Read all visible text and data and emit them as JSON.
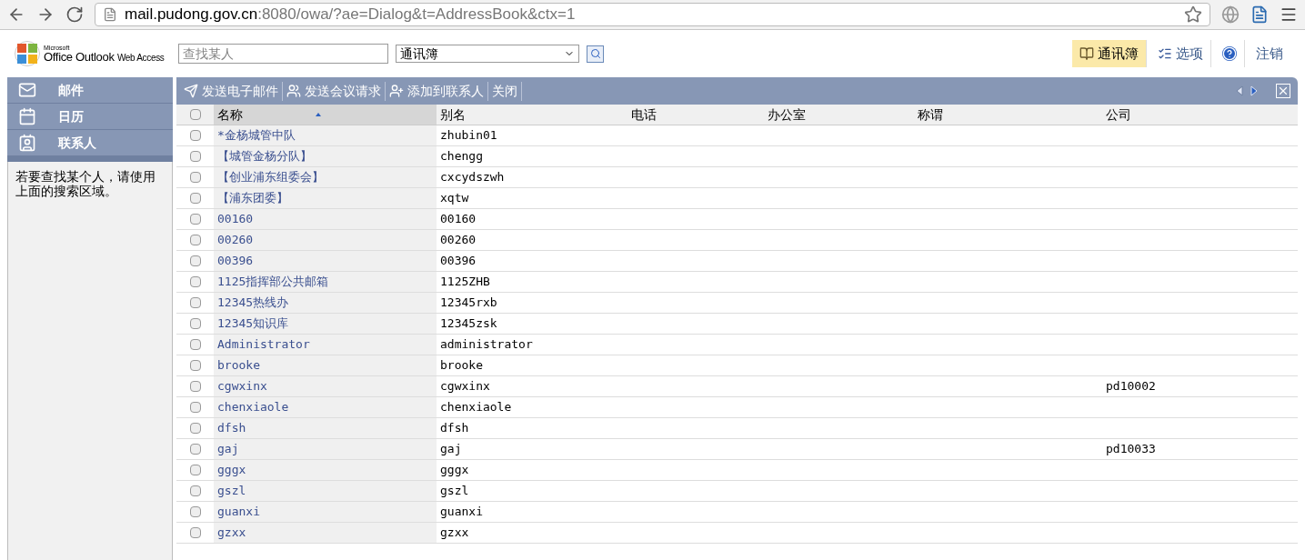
{
  "browser": {
    "url_host": "mail.pudong.gov.cn",
    "url_rest": ":8080/owa/?ae=Dialog&t=AddressBook&ctx=1"
  },
  "header": {
    "logo_small": "Microsoft",
    "logo_main": "Office Outlook",
    "logo_sub": "Web Access",
    "search": {
      "placeholder": "查找某人"
    },
    "book_select": "通讯簿",
    "links": [
      {
        "kind": "book",
        "label": "通讯簿",
        "selected": true
      },
      {
        "kind": "options",
        "label": "选项",
        "selected": false
      },
      {
        "kind": "help",
        "selected": false
      },
      {
        "kind": "plain",
        "label": "注销",
        "selected": false
      }
    ]
  },
  "sidebar": {
    "items": [
      {
        "kind": "mail",
        "label": "邮件"
      },
      {
        "kind": "calendar",
        "label": "日历"
      },
      {
        "kind": "contacts",
        "label": "联系人"
      }
    ],
    "hint": "若要查找某个人，请使用上面的搜索区域。"
  },
  "toolbar": [
    {
      "kind": "mail",
      "label": "发送电子邮件"
    },
    {
      "kind": "meeting",
      "label": "发送会议请求"
    },
    {
      "kind": "add",
      "label": "添加到联系人"
    },
    {
      "kind": "plain",
      "label": "关闭"
    }
  ],
  "table": {
    "select_all": {
      "checked": false
    },
    "columns": [
      {
        "label": "名称",
        "sorted": true
      },
      {
        "label": "别名",
        "sorted": false
      },
      {
        "label": "电话",
        "sorted": false
      },
      {
        "label": "办公室",
        "sorted": false
      },
      {
        "label": "称谓",
        "sorted": false
      },
      {
        "label": "公司",
        "sorted": false
      }
    ],
    "rows": [
      {
        "checked": false,
        "cells": [
          "*金杨城管中队",
          "zhubin01",
          "",
          "",
          "",
          ""
        ]
      },
      {
        "checked": false,
        "cells": [
          "【城管金杨分队】",
          "chengg",
          "",
          "",
          "",
          ""
        ]
      },
      {
        "checked": false,
        "cells": [
          "【创业浦东组委会】",
          "cxcydszwh",
          "",
          "",
          "",
          ""
        ]
      },
      {
        "checked": false,
        "cells": [
          "【浦东团委】",
          "xqtw",
          "",
          "",
          "",
          ""
        ]
      },
      {
        "checked": false,
        "cells": [
          "00160",
          "00160",
          "",
          "",
          "",
          ""
        ]
      },
      {
        "checked": false,
        "cells": [
          "00260",
          "00260",
          "",
          "",
          "",
          ""
        ]
      },
      {
        "checked": false,
        "cells": [
          "00396",
          "00396",
          "",
          "",
          "",
          ""
        ]
      },
      {
        "checked": false,
        "cells": [
          "1125指挥部公共邮箱",
          "1125ZHB",
          "",
          "",
          "",
          ""
        ]
      },
      {
        "checked": false,
        "cells": [
          "12345热线办",
          "12345rxb",
          "",
          "",
          "",
          ""
        ]
      },
      {
        "checked": false,
        "cells": [
          "12345知识库",
          "12345zsk",
          "",
          "",
          "",
          ""
        ]
      },
      {
        "checked": false,
        "cells": [
          "Administrator",
          "administrator",
          "",
          "",
          "",
          ""
        ]
      },
      {
        "checked": false,
        "cells": [
          "brooke",
          "brooke",
          "",
          "",
          "",
          ""
        ]
      },
      {
        "checked": false,
        "cells": [
          "cgwxinx",
          "cgwxinx",
          "",
          "",
          "",
          "pd10002"
        ]
      },
      {
        "checked": false,
        "cells": [
          "chenxiaole",
          "chenxiaole",
          "",
          "",
          "",
          ""
        ]
      },
      {
        "checked": false,
        "cells": [
          "dfsh",
          "dfsh",
          "",
          "",
          "",
          ""
        ]
      },
      {
        "checked": false,
        "cells": [
          "gaj",
          "gaj",
          "",
          "",
          "",
          "pd10033"
        ]
      },
      {
        "checked": false,
        "cells": [
          "gggx",
          "gggx",
          "",
          "",
          "",
          ""
        ]
      },
      {
        "checked": false,
        "cells": [
          "gszl",
          "gszl",
          "",
          "",
          "",
          ""
        ]
      },
      {
        "checked": false,
        "cells": [
          "guanxi",
          "guanxi",
          "",
          "",
          "",
          ""
        ]
      },
      {
        "checked": false,
        "cells": [
          "gzxx",
          "gzxx",
          "",
          "",
          "",
          ""
        ]
      }
    ]
  }
}
